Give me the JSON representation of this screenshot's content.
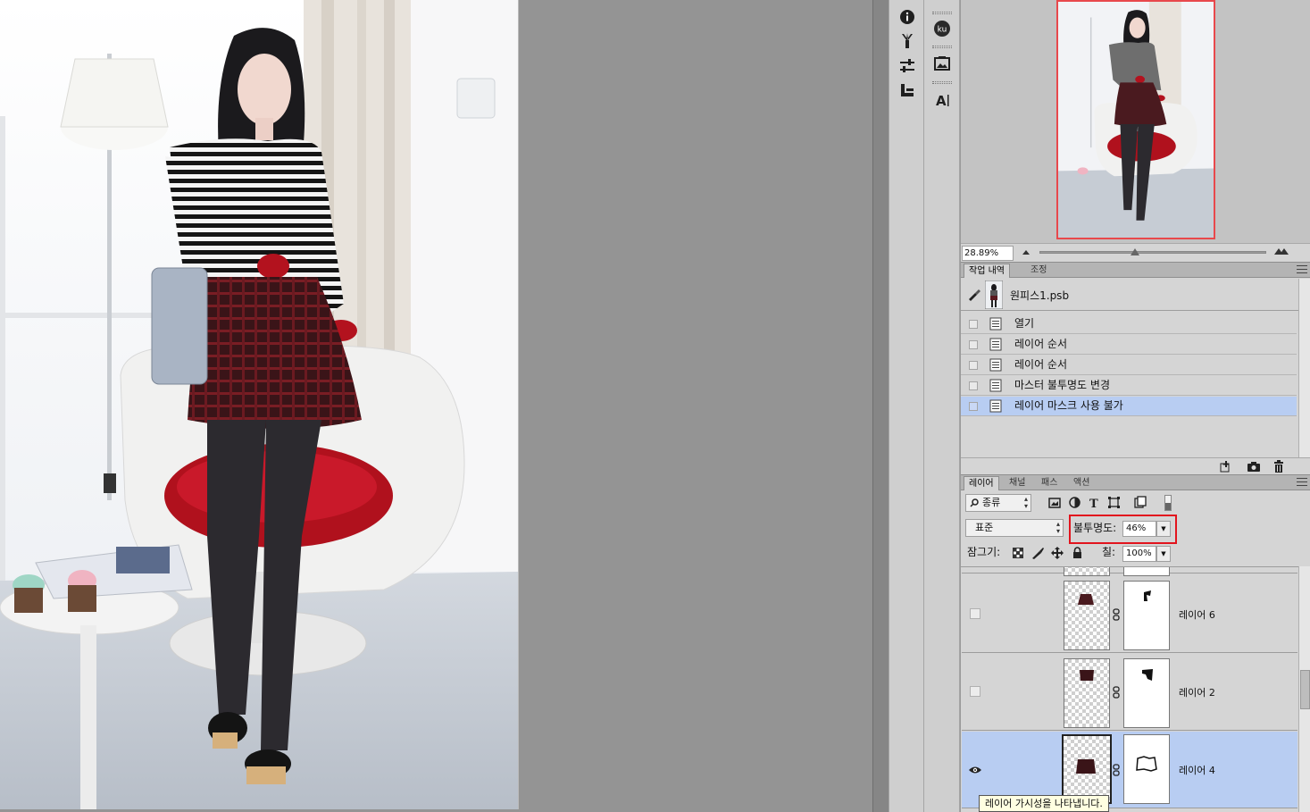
{
  "navigator": {
    "zoom": "28.89%",
    "zoom_slider_fraction": 0.42
  },
  "history_panel": {
    "tabs": [
      {
        "label": "작업 내역",
        "active": true
      },
      {
        "label": "조정",
        "active": false
      }
    ],
    "snapshot_name": "원피스1.psb",
    "items": [
      {
        "label": "열기",
        "selected": false
      },
      {
        "label": "레이어 순서",
        "selected": false
      },
      {
        "label": "레이어 순서",
        "selected": false
      },
      {
        "label": "마스터 불투명도 변경",
        "selected": false
      },
      {
        "label": "레이어 마스크 사용 불가",
        "selected": true
      }
    ]
  },
  "layers_panel": {
    "tabs": [
      {
        "label": "레이어",
        "active": true
      },
      {
        "label": "채널",
        "active": false
      },
      {
        "label": "패스",
        "active": false
      },
      {
        "label": "액션",
        "active": false
      }
    ],
    "filter_kind": "종류",
    "blend_mode": "표준",
    "opacity_label": "불투명도:",
    "opacity_value": "46%",
    "lock_label": "잠그기:",
    "fill_label": "칠:",
    "fill_value": "100%",
    "layers": [
      {
        "name": "레이어 6",
        "visible": false,
        "selected": false
      },
      {
        "name": "레이어 2",
        "visible": false,
        "selected": false
      },
      {
        "name": "레이어 4",
        "visible": true,
        "selected": true
      }
    ]
  },
  "tooltip": {
    "text": "레이어 가시성을 나타냅니다."
  },
  "colors": {
    "selection": "#b8cdf2",
    "highlight_box": "#e2141d",
    "navigator_frame": "#e8484c",
    "canvas_background": "#949494"
  },
  "icons": {
    "tools_column_1": [
      "info-icon",
      "brush-presets-icon",
      "adjustments-icon",
      "clone-source-icon"
    ],
    "tools_column_2": [
      "kuler-icon",
      "image-icon",
      "character-icon"
    ]
  }
}
